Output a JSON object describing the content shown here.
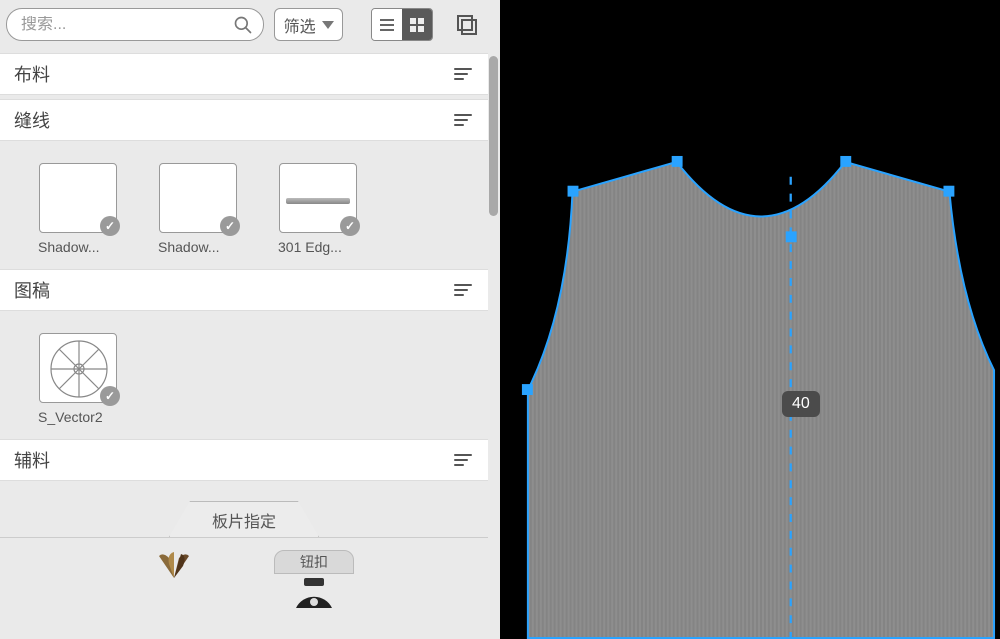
{
  "search": {
    "placeholder": "搜索..."
  },
  "filter": {
    "label": "筛选"
  },
  "sections": {
    "fabric": "布料",
    "stitch": "缝线",
    "graphic": "图稿",
    "trim": "辅料"
  },
  "stitch_items": [
    {
      "label": "Shadow..."
    },
    {
      "label": "Shadow..."
    },
    {
      "label": "301 Edg..."
    }
  ],
  "graphic_items": [
    {
      "label": "S_Vector2"
    }
  ],
  "assign": {
    "tab_label": "板片指定",
    "button_label": "钮扣"
  },
  "viewport": {
    "measurement_value": "40"
  }
}
